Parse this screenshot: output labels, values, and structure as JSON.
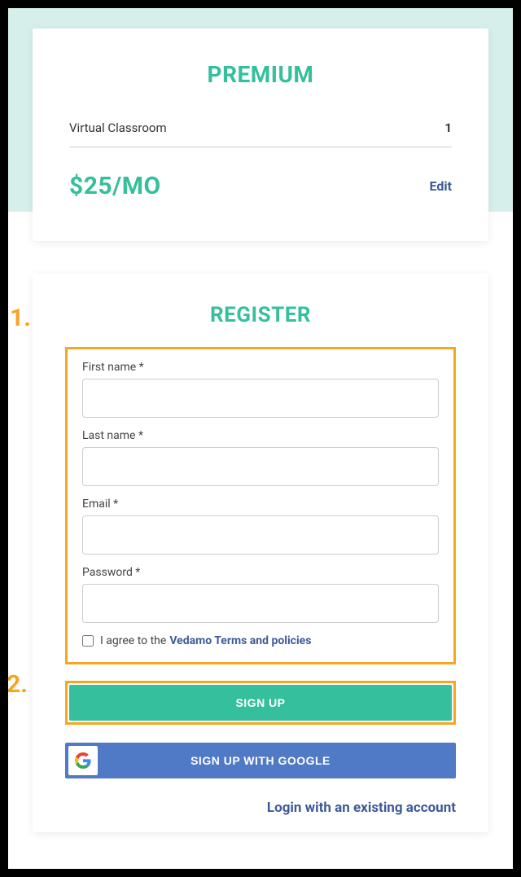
{
  "premium": {
    "title": "PREMIUM",
    "item_label": "Virtual Classroom",
    "item_qty": "1",
    "price": "$25/MO",
    "edit_label": "Edit"
  },
  "register": {
    "title": "REGISTER",
    "step1": "1.",
    "step2": "2.",
    "first_name_label": "First name *",
    "last_name_label": "Last name *",
    "email_label": "Email *",
    "password_label": "Password *",
    "agree_prefix": "I agree to the",
    "terms_link": "Vedamo Terms and policies",
    "signup_label": "SIGN UP",
    "google_label": "SIGN UP WITH GOOGLE",
    "login_link": "Login with an existing account"
  }
}
